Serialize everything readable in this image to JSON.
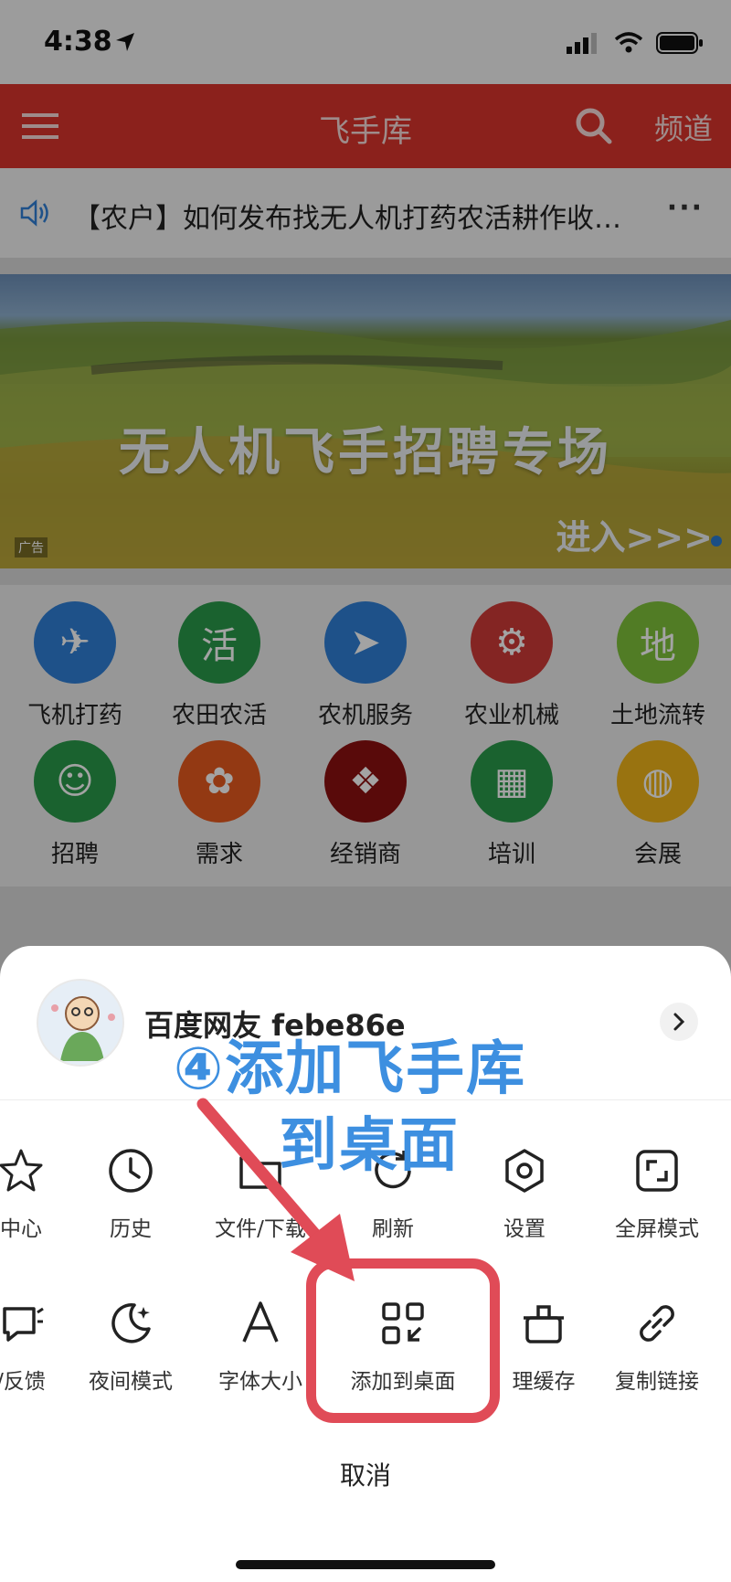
{
  "status": {
    "time": "4:38"
  },
  "appbar": {
    "title": "飞手库",
    "channel": "频道"
  },
  "notice": {
    "text": "【农户】如何发布找无人机打药农活耕作收…",
    "more": "···"
  },
  "banner": {
    "title": "无人机飞手招聘专场",
    "ad": "广告",
    "enter": "进入>>>"
  },
  "grid": [
    {
      "label": "飞机打药",
      "icon": "drone-icon",
      "color": "#2f7fd6"
    },
    {
      "label": "农田农活",
      "icon": "farm-icon",
      "color": "#2a9a4a"
    },
    {
      "label": "农机服务",
      "icon": "tractor-service-icon",
      "color": "#2f7fd6"
    },
    {
      "label": "农业机械",
      "icon": "tractor-icon",
      "color": "#cf3a37"
    },
    {
      "label": "土地流转",
      "icon": "land-icon",
      "color": "#7fc23a"
    },
    {
      "label": "招聘",
      "icon": "people-icon",
      "color": "#2a9a4a"
    },
    {
      "label": "需求",
      "icon": "demand-icon",
      "color": "#e65a1e"
    },
    {
      "label": "经销商",
      "icon": "china-map-icon",
      "color": "#8c1010"
    },
    {
      "label": "培训",
      "icon": "building-icon",
      "color": "#2a9a4a"
    },
    {
      "label": "会展",
      "icon": "globe-icon",
      "color": "#f0b419"
    }
  ],
  "sheet": {
    "username": "百度网友 febe86e",
    "row1": [
      {
        "label": "中心",
        "icon": "star-icon"
      },
      {
        "label": "历史",
        "icon": "clock-icon"
      },
      {
        "label": "文件/下载",
        "icon": "folder-icon"
      },
      {
        "label": "刷新",
        "icon": "refresh-icon"
      },
      {
        "label": "设置",
        "icon": "settings-icon"
      },
      {
        "label": "全屏模式",
        "icon": "fullscreen-icon"
      }
    ],
    "row2": [
      {
        "label": "/反馈",
        "icon": "feedback-icon"
      },
      {
        "label": "夜间模式",
        "icon": "moon-icon"
      },
      {
        "label": "字体大小",
        "icon": "font-size-icon"
      },
      {
        "label": "添加到桌面",
        "icon": "add-to-desktop-icon"
      },
      {
        "label": "理缓存",
        "icon": "clear-cache-icon"
      },
      {
        "label": "复制链接",
        "icon": "link-icon"
      }
    ],
    "cancel": "取消"
  },
  "annotation": {
    "line1": "④添加飞手库",
    "line2": "到桌面"
  },
  "colors": {
    "appbar": "#d9352c",
    "annotation": "#3d8fe0",
    "highlight": "#e04b57"
  }
}
